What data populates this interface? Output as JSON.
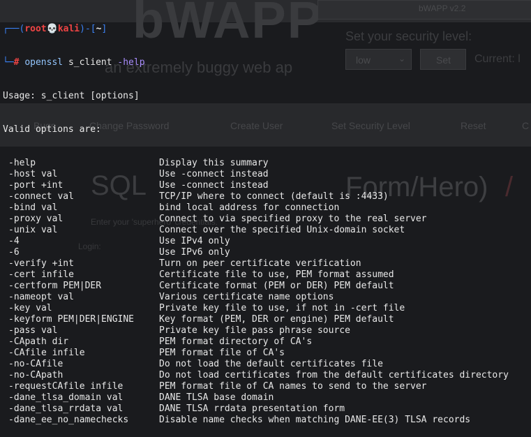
{
  "background": {
    "logo_text": "bWAPP",
    "version": "bWAPP v2.2",
    "security_label": "Set your security level:",
    "security_select_value": "low",
    "set_button": "Set",
    "current_label": "Current: l",
    "tagline": "an extremely buggy web ap",
    "nav_items": [
      "Bugs",
      "Change Password",
      "Create User",
      "Set Security Level",
      "Reset",
      "C"
    ],
    "page_title_left": "SQL",
    "page_title_right": "Form/Hero)",
    "page_title_slash": "/",
    "input_placeholder": "Enter your 'superhero' credentials.",
    "login_label": "Login:"
  },
  "terminal": {
    "prompt": {
      "frame_top": "┌──(",
      "user": "root",
      "skull": "💀",
      "host": "kali",
      "frame_mid": ")-[",
      "path": "~",
      "frame_end": "]",
      "frame_bottom": "└─",
      "hash": "#",
      "command": "openssl",
      "arg": "s_client",
      "flag": "-help"
    },
    "usage": "Usage: s_client [options]",
    "valid_options": "Valid options are:",
    "options": [
      {
        "opt": "-help",
        "desc": "Display this summary"
      },
      {
        "opt": "-host val",
        "desc": "Use -connect instead"
      },
      {
        "opt": "-port +int",
        "desc": "Use -connect instead"
      },
      {
        "opt": "-connect val",
        "desc": "TCP/IP where to connect (default is :4433)"
      },
      {
        "opt": "-bind val",
        "desc": "bind local address for connection"
      },
      {
        "opt": "-proxy val",
        "desc": "Connect to via specified proxy to the real server"
      },
      {
        "opt": "-unix val",
        "desc": "Connect over the specified Unix-domain socket"
      },
      {
        "opt": "-4",
        "desc": "Use IPv4 only"
      },
      {
        "opt": "-6",
        "desc": "Use IPv6 only"
      },
      {
        "opt": "-verify +int",
        "desc": "Turn on peer certificate verification"
      },
      {
        "opt": "-cert infile",
        "desc": "Certificate file to use, PEM format assumed"
      },
      {
        "opt": "-certform PEM|DER",
        "desc": "Certificate format (PEM or DER) PEM default"
      },
      {
        "opt": "-nameopt val",
        "desc": "Various certificate name options"
      },
      {
        "opt": "-key val",
        "desc": "Private key file to use, if not in -cert file"
      },
      {
        "opt": "-keyform PEM|DER|ENGINE",
        "desc": "Key format (PEM, DER or engine) PEM default"
      },
      {
        "opt": "-pass val",
        "desc": "Private key file pass phrase source"
      },
      {
        "opt": "-CApath dir",
        "desc": "PEM format directory of CA's"
      },
      {
        "opt": "-CAfile infile",
        "desc": "PEM format file of CA's"
      },
      {
        "opt": "-no-CAfile",
        "desc": "Do not load the default certificates file"
      },
      {
        "opt": "-no-CApath",
        "desc": "Do not load certificates from the default certificates directory"
      },
      {
        "opt": "-requestCAfile infile",
        "desc": "PEM format file of CA names to send to the server"
      },
      {
        "opt": "-dane_tlsa_domain val",
        "desc": "DANE TLSA base domain"
      },
      {
        "opt": "-dane_tlsa_rrdata val",
        "desc": "DANE TLSA rrdata presentation form"
      },
      {
        "opt": "-dane_ee_no_namechecks",
        "desc": "Disable name checks when matching DANE-EE(3) TLSA records"
      }
    ]
  },
  "colors": {
    "terminal_bg": "#1a1b1e",
    "text": "#e8e8e8",
    "prompt_frame": "#3b82f6",
    "prompt_user": "#ef4444",
    "command": "#93c5fd",
    "flag": "#a78bfa"
  }
}
